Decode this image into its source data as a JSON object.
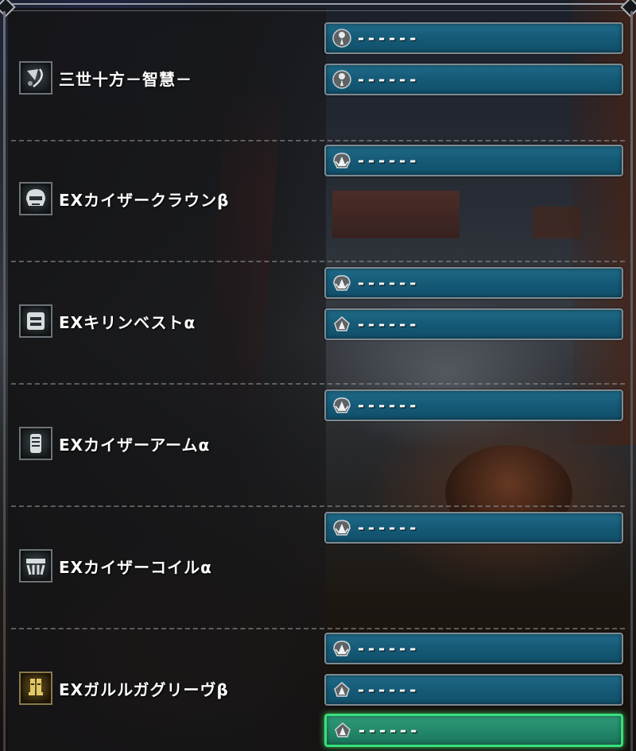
{
  "items": [
    {
      "name": "三世十方－智慧－",
      "icon": "charm-icon",
      "slots": [
        {
          "type": "size1",
          "icon": "decoration-slot-size1-icon",
          "text": "------"
        },
        {
          "type": "size1",
          "icon": "decoration-slot-size1-icon",
          "text": "------"
        }
      ]
    },
    {
      "name": "EXカイザークラウンβ",
      "icon": "helm-icon",
      "slots": [
        {
          "type": "size4",
          "icon": "decoration-slot-size4-icon",
          "text": "------"
        }
      ]
    },
    {
      "name": "EXキリンベストα",
      "icon": "chest-icon",
      "slots": [
        {
          "type": "size4",
          "icon": "decoration-slot-size4-icon",
          "text": "------"
        },
        {
          "type": "size3",
          "icon": "decoration-slot-size3-icon",
          "text": "------"
        }
      ]
    },
    {
      "name": "EXカイザーアームα",
      "icon": "arm-icon",
      "slots": [
        {
          "type": "size4",
          "icon": "decoration-slot-size4-icon",
          "text": "------"
        }
      ]
    },
    {
      "name": "EXカイザーコイルα",
      "icon": "waist-icon",
      "slots": [
        {
          "type": "size4",
          "icon": "decoration-slot-size4-icon",
          "text": "------"
        }
      ]
    },
    {
      "name": "EXガルルガグリーヴβ",
      "icon": "legs-icon",
      "slots": [
        {
          "type": "size4",
          "icon": "decoration-slot-size4-icon",
          "text": "------"
        },
        {
          "type": "size3",
          "icon": "decoration-slot-size3-icon",
          "text": "------"
        },
        {
          "type": "size3",
          "icon": "decoration-slot-size3-icon",
          "text": "------",
          "selected": true
        }
      ]
    }
  ],
  "colors": {
    "slot_bg": "#155a76",
    "slot_selected_border": "#38e07a",
    "text": "#ffffff"
  }
}
